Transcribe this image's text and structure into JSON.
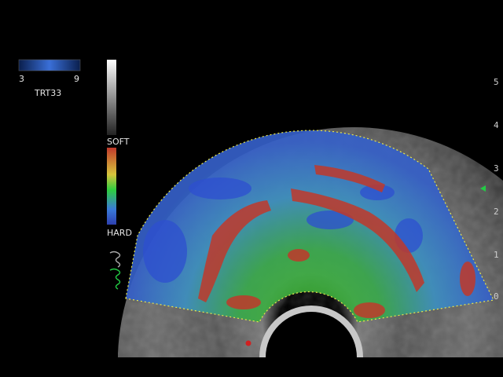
{
  "speed_scale": {
    "min": "3",
    "max": "9",
    "colors": {
      "dark": "#0a1f4d",
      "bright": "#3a6fd8"
    }
  },
  "preset": "TRT33",
  "elasto_scale": {
    "soft_label": "SOFT",
    "hard_label": "HARD"
  },
  "depth_marks": [
    "5",
    "4",
    "3",
    "2",
    "1",
    "0"
  ],
  "colors": {
    "soft": "#c0392b",
    "mid": "#2ecc40",
    "hard": "#2d4fd0",
    "roi_outline": "#e8e84a",
    "marker": "#d02020",
    "focus": "#22cc44"
  }
}
